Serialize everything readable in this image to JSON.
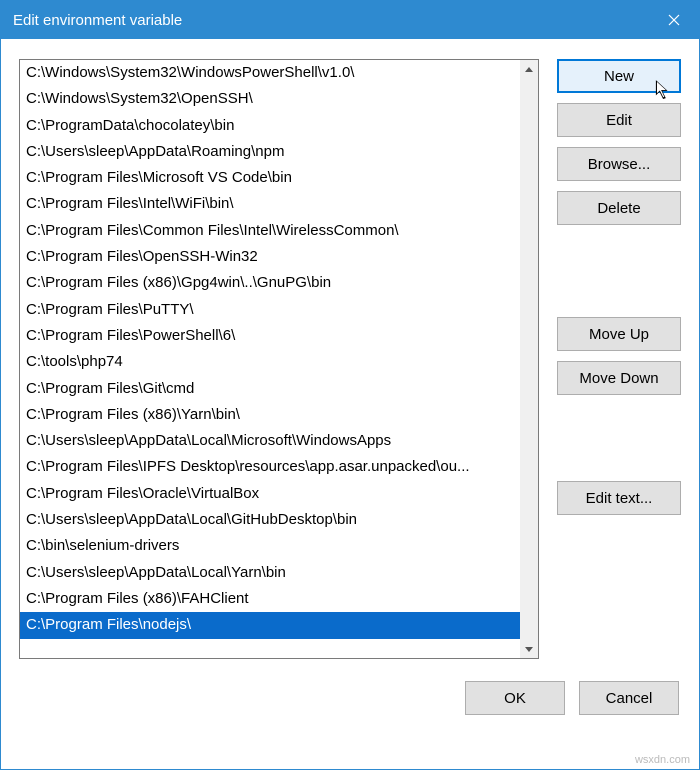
{
  "window": {
    "title": "Edit environment variable"
  },
  "list": {
    "items": [
      "C:\\Windows\\System32\\WindowsPowerShell\\v1.0\\",
      "C:\\Windows\\System32\\OpenSSH\\",
      "C:\\ProgramData\\chocolatey\\bin",
      "C:\\Users\\sleep\\AppData\\Roaming\\npm",
      "C:\\Program Files\\Microsoft VS Code\\bin",
      "C:\\Program Files\\Intel\\WiFi\\bin\\",
      "C:\\Program Files\\Common Files\\Intel\\WirelessCommon\\",
      "C:\\Program Files\\OpenSSH-Win32",
      "C:\\Program Files (x86)\\Gpg4win\\..\\GnuPG\\bin",
      "C:\\Program Files\\PuTTY\\",
      "C:\\Program Files\\PowerShell\\6\\",
      "C:\\tools\\php74",
      "C:\\Program Files\\Git\\cmd",
      "C:\\Program Files (x86)\\Yarn\\bin\\",
      "C:\\Users\\sleep\\AppData\\Local\\Microsoft\\WindowsApps",
      "C:\\Program Files\\IPFS Desktop\\resources\\app.asar.unpacked\\ou...",
      "C:\\Program Files\\Oracle\\VirtualBox",
      "C:\\Users\\sleep\\AppData\\Local\\GitHubDesktop\\bin",
      "C:\\bin\\selenium-drivers",
      "C:\\Users\\sleep\\AppData\\Local\\Yarn\\bin",
      "C:\\Program Files (x86)\\FAHClient",
      "C:\\Program Files\\nodejs\\"
    ],
    "selected_index": 21
  },
  "buttons": {
    "new": "New",
    "edit": "Edit",
    "browse": "Browse...",
    "delete": "Delete",
    "move_up": "Move Up",
    "move_down": "Move Down",
    "edit_text": "Edit text...",
    "ok": "OK",
    "cancel": "Cancel"
  },
  "watermark": "wsxdn.com"
}
